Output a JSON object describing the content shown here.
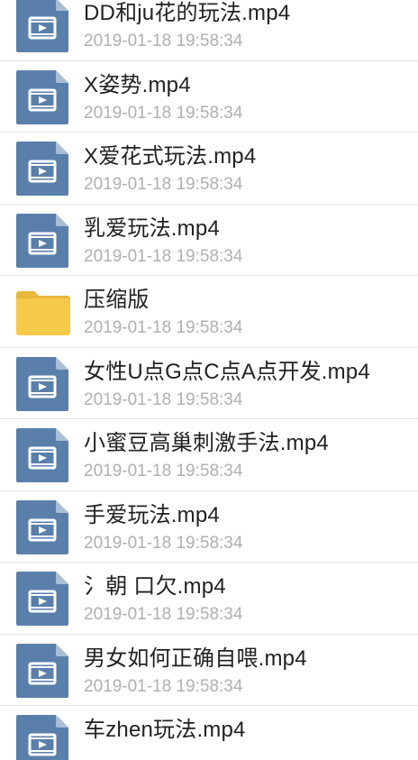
{
  "files": [
    {
      "type": "video",
      "icon": "video-file-icon",
      "name": "DD和ju花的玩法.mp4",
      "time": "2019-01-18 19:58:34"
    },
    {
      "type": "video",
      "icon": "video-file-icon",
      "name": "X姿势.mp4",
      "time": "2019-01-18 19:58:34"
    },
    {
      "type": "video",
      "icon": "video-file-icon",
      "name": "X爱花式玩法.mp4",
      "time": "2019-01-18 19:58:34"
    },
    {
      "type": "video",
      "icon": "video-file-icon",
      "name": "乳爱玩法.mp4",
      "time": "2019-01-18 19:58:34"
    },
    {
      "type": "folder",
      "icon": "folder-icon",
      "name": "压缩版",
      "time": "2019-01-18 19:58:34"
    },
    {
      "type": "video",
      "icon": "video-file-icon",
      "name": "女性U点G点C点A点开发.mp4",
      "time": "2019-01-18 19:58:34"
    },
    {
      "type": "video",
      "icon": "video-file-icon",
      "name": "小蜜豆高巢刺激手法.mp4",
      "time": "2019-01-18 19:58:34"
    },
    {
      "type": "video",
      "icon": "video-file-icon",
      "name": "手爱玩法.mp4",
      "time": "2019-01-18 19:58:34"
    },
    {
      "type": "video",
      "icon": "video-file-icon",
      "name": "氵朝 口欠.mp4",
      "time": "2019-01-18 19:58:34"
    },
    {
      "type": "video",
      "icon": "video-file-icon",
      "name": "男女如何正确自喂.mp4",
      "time": "2019-01-18 19:58:34"
    },
    {
      "type": "video",
      "icon": "video-file-icon",
      "name": "车zhen玩法.mp4",
      "time": ""
    }
  ],
  "colors": {
    "video_icon": "#5a7fab",
    "video_icon_fold": "#a9bdd5",
    "folder_icon": "#f5c94a",
    "folder_tab": "#e9b83b"
  }
}
